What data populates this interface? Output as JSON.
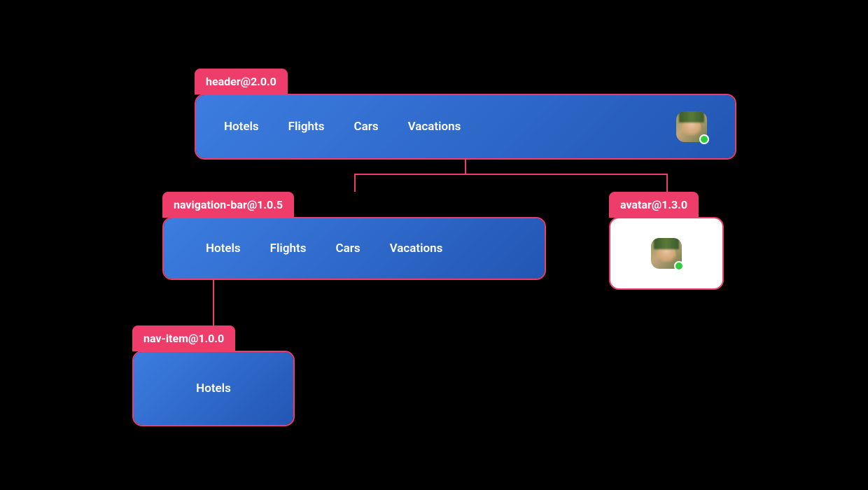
{
  "components": {
    "header": {
      "label": "header@2.0.0",
      "navItems": [
        "Hotels",
        "Flights",
        "Cars",
        "Vacations"
      ]
    },
    "navigationBar": {
      "label": "navigation-bar@1.0.5",
      "navItems": [
        "Hotels",
        "Flights",
        "Cars",
        "Vacations"
      ]
    },
    "avatar": {
      "label": "avatar@1.3.0"
    },
    "navItem": {
      "label": "nav-item@1.0.0",
      "text": "Hotels"
    }
  },
  "colors": {
    "accent": "#ee3d6a",
    "panelGradientStart": "#3c7de0",
    "panelGradientEnd": "#2256b4",
    "statusOnline": "#2ecc40"
  }
}
